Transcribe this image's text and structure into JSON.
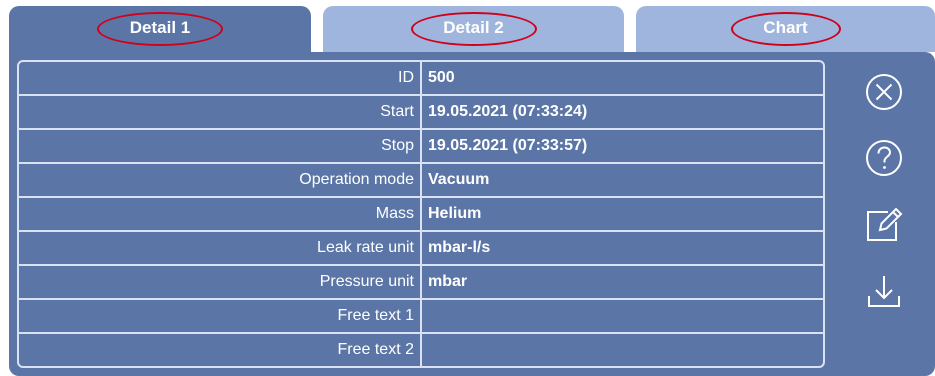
{
  "tabs": [
    {
      "label": "Detail 1",
      "active": true
    },
    {
      "label": "Detail 2",
      "active": false
    },
    {
      "label": "Chart",
      "active": false
    }
  ],
  "details": [
    {
      "label": "ID",
      "value": "500"
    },
    {
      "label": "Start",
      "value": "19.05.2021 (07:33:24)"
    },
    {
      "label": "Stop",
      "value": "19.05.2021 (07:33:57)"
    },
    {
      "label": "Operation mode",
      "value": "Vacuum"
    },
    {
      "label": "Mass",
      "value": "Helium"
    },
    {
      "label": "Leak rate unit",
      "value": "mbar-l/s"
    },
    {
      "label": "Pressure unit",
      "value": "mbar"
    },
    {
      "label": "Free text 1",
      "value": ""
    },
    {
      "label": "Free text 2",
      "value": ""
    }
  ],
  "actions": [
    {
      "icon": "close-circle-icon"
    },
    {
      "icon": "help-circle-icon"
    },
    {
      "icon": "edit-icon"
    },
    {
      "icon": "download-icon"
    }
  ],
  "colors": {
    "panel": "#5b76a6",
    "tab_inactive": "#9fb5dd",
    "grid_line": "#d9e2f2",
    "highlight_oval": "#d0021b"
  }
}
